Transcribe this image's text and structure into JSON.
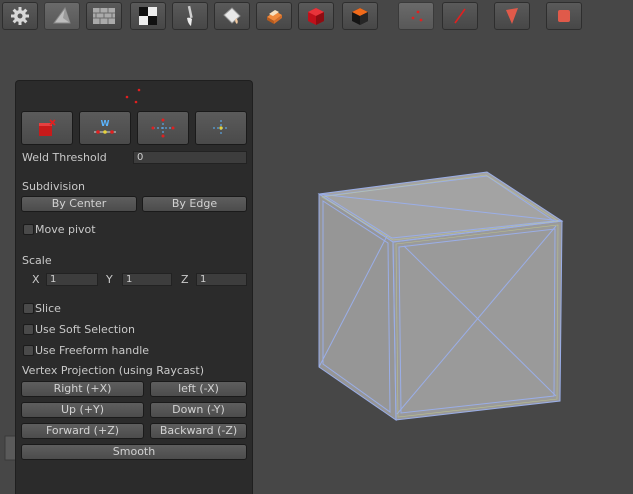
{
  "toolbar": {
    "buttons": [
      {
        "icon": "gear-icon",
        "active": false
      },
      {
        "icon": "shape-icon",
        "active": true
      },
      {
        "icon": "brick-icon",
        "active": false
      },
      {
        "icon": "checker-icon",
        "active": false
      },
      {
        "icon": "brush-icon",
        "active": false
      },
      {
        "icon": "paint-bucket-icon",
        "active": false
      },
      {
        "icon": "uv-icon",
        "active": false
      },
      {
        "icon": "red-cube-icon",
        "active": false
      },
      {
        "icon": "black-cube-icon",
        "active": false
      },
      {
        "icon": "vertex-mode-icon",
        "active": true
      },
      {
        "icon": "edge-mode-icon",
        "active": false
      },
      {
        "icon": "face-mode-icon",
        "active": false
      },
      {
        "icon": "object-mode-icon",
        "active": false
      }
    ]
  },
  "panel": {
    "icon_buttons": [
      "collapse-vertices-icon",
      "weld-vertices-icon",
      "connect-vertices-icon",
      "split-vertices-icon"
    ],
    "weld_threshold_label": "Weld Threshold",
    "weld_threshold_value": "0",
    "subdivision_label": "Subdivision",
    "by_center": "By Center",
    "by_edge": "By Edge",
    "move_pivot": "Move pivot",
    "scale_label": "Scale",
    "scale": {
      "x_label": "X",
      "x": "1",
      "y_label": "Y",
      "y": "1",
      "z_label": "Z",
      "z": "1"
    },
    "slice": "Slice",
    "use_soft_selection": "Use Soft Selection",
    "use_freeform_handle": "Use Freeform handle",
    "vertex_projection_label": "Vertex Projection (using Raycast)",
    "right": "Right (+X)",
    "left": "left (-X)",
    "up": "Up (+Y)",
    "down": "Down (-Y)",
    "forward": "Forward (+Z)",
    "backward": "Backward (-Z)",
    "smooth": "Smooth"
  },
  "colors": {
    "background": "#474747",
    "panel": "#2b2b2b",
    "selection_red": "#e02020",
    "wire_blue": "#9aaee8",
    "cube_face": "#999999"
  }
}
